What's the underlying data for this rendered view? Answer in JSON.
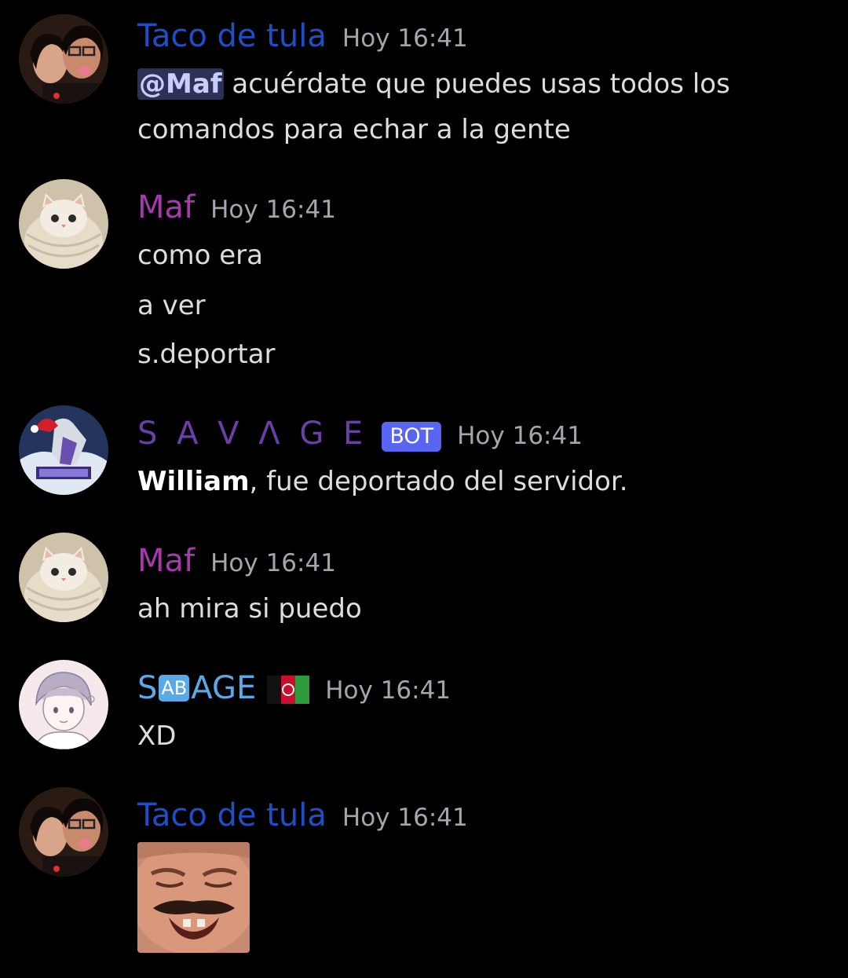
{
  "messages": [
    {
      "username": "Taco de tula",
      "username_color": "#1f4fc8",
      "timestamp": "Hoy 16:41",
      "avatar": "couple-photo-avatar",
      "mention": "@Maf",
      "text_after_mention": " acuérdate que puedes usas todos los",
      "line2": "comandos para echar a la gente"
    },
    {
      "username": "Maf",
      "username_color": "#a53aac",
      "timestamp": "Hoy 16:41",
      "avatar": "cat-avatar",
      "lines": [
        "como era",
        "a ver",
        "s.deportar"
      ]
    },
    {
      "username": "S A V Λ G E",
      "username_color": "#6b3fa8",
      "bot_tag": "BOT",
      "timestamp": "Hoy 16:41",
      "avatar": "wolf-logo-avatar",
      "bold_text": "William",
      "text": ", fue deportado del servidor."
    },
    {
      "username": "Maf",
      "username_color": "#a53aac",
      "timestamp": "Hoy 16:41",
      "avatar": "cat-avatar",
      "lines": [
        "ah mira si puedo"
      ]
    },
    {
      "username_prefix": "S",
      "username_badge": "AB",
      "username_suffix": "AGE",
      "username_color": "#5aa8e6",
      "flag": "afghanistan-flag-icon",
      "timestamp": "Hoy 16:41",
      "avatar": "anime-boy-avatar",
      "lines": [
        "XD"
      ]
    },
    {
      "username": "Taco de tula",
      "username_color": "#1f4fc8",
      "timestamp": "Hoy 16:41",
      "avatar": "couple-photo-avatar",
      "image": "laughing-man-emoji-image"
    }
  ]
}
